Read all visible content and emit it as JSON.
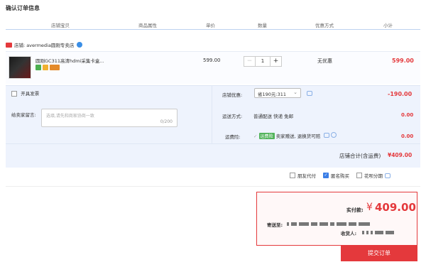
{
  "page_title": "确认订单信息",
  "columns": [
    "店铺宝贝",
    "商品属性",
    "单价",
    "数量",
    "优惠方式",
    "小计"
  ],
  "shop": {
    "label": "店铺:",
    "name": "avermedia圆刚专卖店"
  },
  "item": {
    "name": "圆刚GC311高清hdmi采集卡盒...",
    "price": "599.00",
    "quantity": "1",
    "discount": "无优惠",
    "subtotal": "599.00"
  },
  "options": {
    "invoice_label": "开具发票",
    "message_label": "给卖家留言:",
    "message_placeholder": "选填,请先和商家协商一致",
    "message_count": "0/200",
    "shop_discount_label": "店铺优惠:",
    "shop_discount_value": "省190元:311",
    "shop_discount_amount": "-190.00",
    "delivery_label": "运送方式:",
    "delivery_value": "普通配送 快递 免邮",
    "delivery_amount": "0.00",
    "insurance_label": "运费险:",
    "insurance_badge": "运费险",
    "insurance_text": "卖家赠送, 退换货可赔",
    "insurance_amount": "0.00"
  },
  "shop_total": {
    "label": "店铺合计(含运费)",
    "value": "¥409.00"
  },
  "extras": [
    "朋友代付",
    "匿名购买",
    "花呗分期"
  ],
  "summary": {
    "pay_label": "实付款:",
    "currency": "¥",
    "pay_amount": "409.00",
    "ship_to_label": "寄送至:",
    "receiver_label": "收货人:"
  },
  "submit_label": "提交订单",
  "colors": {
    "accent": "#e4393c",
    "panel": "#eef3fd",
    "checkbox": "#3a7ee6"
  }
}
